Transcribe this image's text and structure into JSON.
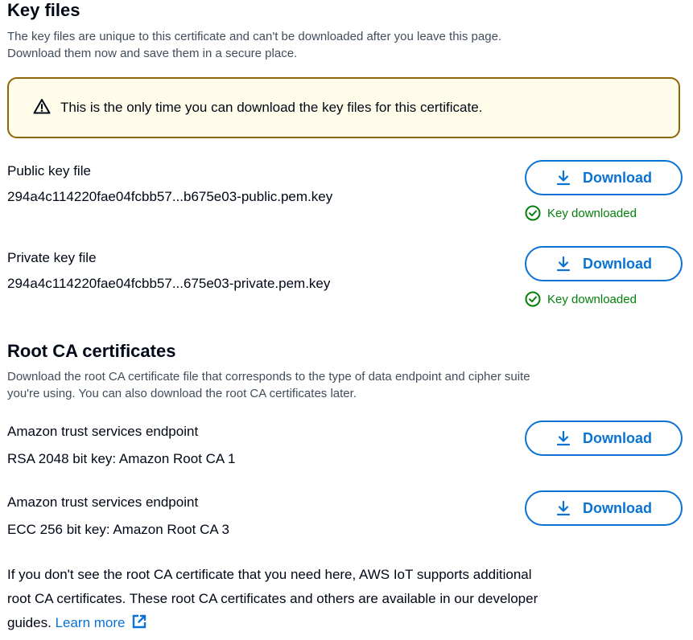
{
  "key_files": {
    "heading": "Key files",
    "description_line1": "The key files are unique to this certificate and can't be downloaded after you leave this page.",
    "description_line2": "Download them now and save them in a secure place.",
    "alert": "This is the only time you can download the key files for this certificate.",
    "items": [
      {
        "label": "Public key file",
        "filename": "294a4c114220fae04fcbb57...b675e03-public.pem.key",
        "button": "Download",
        "status": "Key downloaded"
      },
      {
        "label": "Private key file",
        "filename": "294a4c114220fae04fcbb57...675e03-private.pem.key",
        "button": "Download",
        "status": "Key downloaded"
      }
    ]
  },
  "root_ca": {
    "heading": "Root CA certificates",
    "description_line1": "Download the root CA certificate file that corresponds to the type of data endpoint and cipher suite",
    "description_line2": "you're using. You can also download the root CA certificates later.",
    "items": [
      {
        "label": "Amazon trust services endpoint",
        "value": "RSA 2048 bit key: Amazon Root CA 1",
        "button": "Download"
      },
      {
        "label": "Amazon trust services endpoint",
        "value": "ECC 256 bit key: Amazon Root CA 3",
        "button": "Download"
      }
    ]
  },
  "footer": {
    "text_line1": "If you don't see the root CA certificate that you need here, AWS IoT supports additional",
    "text_line2": "root CA certificates. These root CA certificates and others are available in our developer",
    "text_line3": "guides.",
    "link": "Learn more"
  },
  "colors": {
    "accent": "#0972d3",
    "success": "#037f0c",
    "warning_border": "#8d6605",
    "warning_bg": "#fffce9"
  }
}
